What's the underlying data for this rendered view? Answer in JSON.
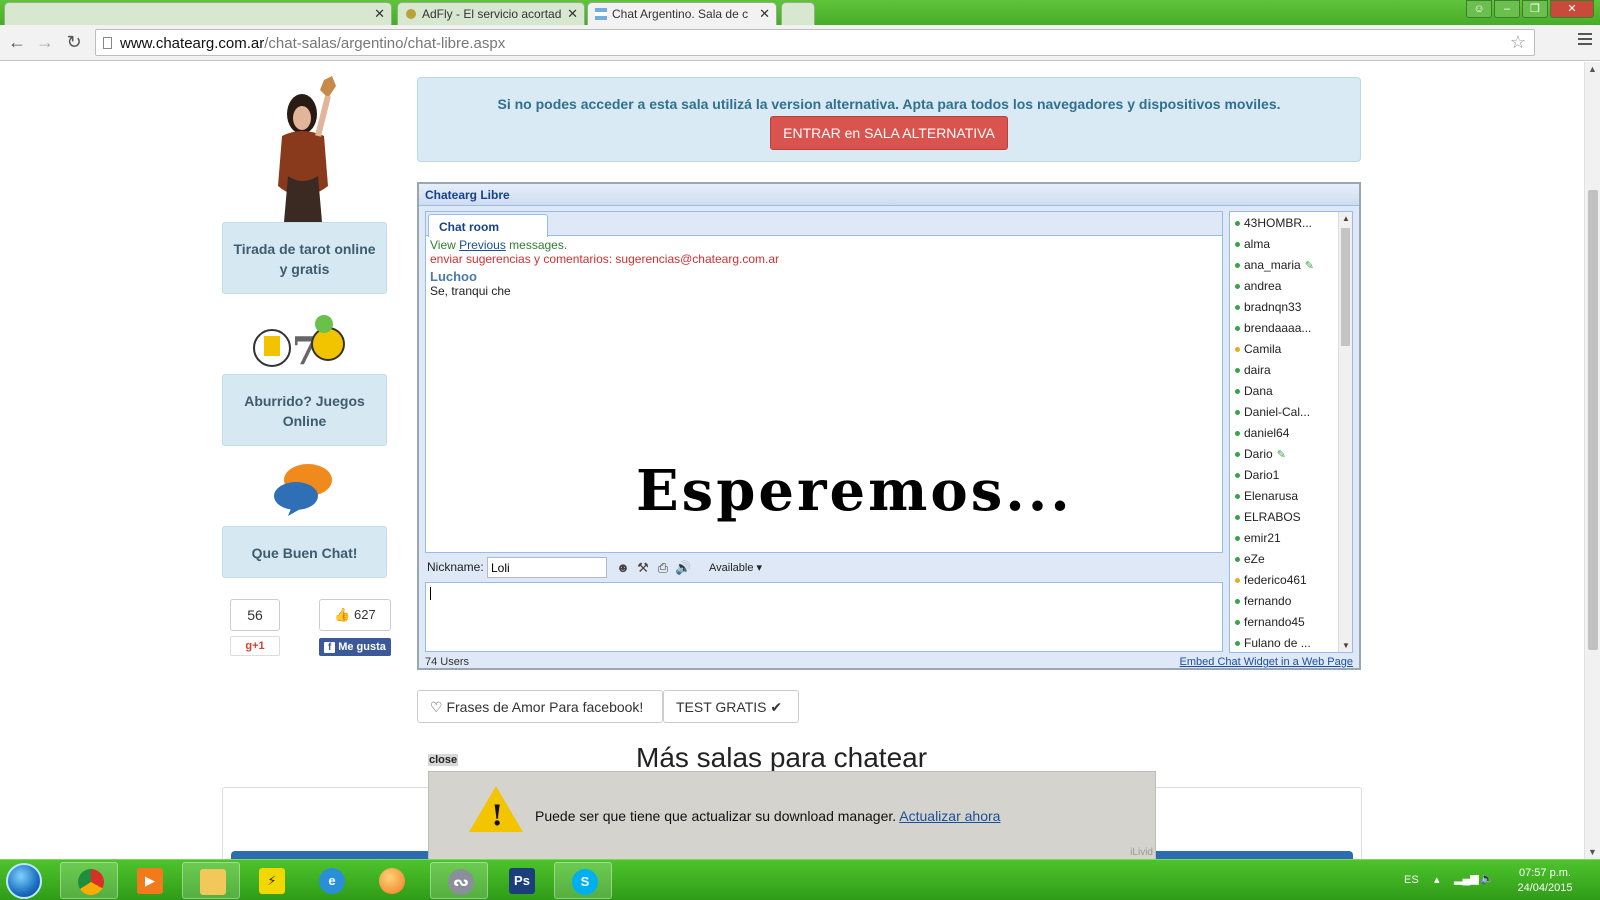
{
  "browser": {
    "tabs": [
      {
        "title": "",
        "active": false
      },
      {
        "title": "AdFly - El servicio acortad",
        "active": false
      },
      {
        "title": "Chat Argentino. Sala de c",
        "active": true
      }
    ],
    "url_host": "www.chatearg.com.ar",
    "url_path": "/chat-salas/argentino/chat-libre.aspx"
  },
  "sidebar": {
    "tarot": "Tirada de tarot online y gratis",
    "games": "Aburrido? Juegos Online",
    "chat": "Que Buen Chat!",
    "gplus_count": "56",
    "gplus_label": "+1",
    "like_count": "627",
    "fb_label": "Me gusta"
  },
  "alert": {
    "text": "Si no podes acceder a esta sala utilizá la version alternativa. Apta para todos los navegadores y dispositivos moviles.",
    "button": "ENTRAR en SALA ALTERNATIVA"
  },
  "chat": {
    "title": "Chatearg Libre",
    "tab": "Chat room",
    "view_prefix": "View ",
    "view_link": "Previous",
    "view_suffix": " messages.",
    "system_msg": "enviar sugerencias y comentarios: sugerencias@chatearg.com.ar",
    "message_user": "Luchoo",
    "message_text": "Se, tranqui che",
    "overlay": "Esperemos...",
    "nickname_label": "Nickname:",
    "nickname_value": "Loli",
    "status": "Available ▾",
    "users_count": "74 Users",
    "embed": "Embed Chat Widget in a Web Page",
    "users": [
      {
        "name": "43HOMBR...",
        "away": false
      },
      {
        "name": "alma",
        "away": false
      },
      {
        "name": "ana_maria",
        "away": false,
        "pen": true
      },
      {
        "name": "andrea",
        "away": false
      },
      {
        "name": "bradnqn33",
        "away": false
      },
      {
        "name": "brendaaaa...",
        "away": false
      },
      {
        "name": "Camila",
        "away": true
      },
      {
        "name": "daira",
        "away": false
      },
      {
        "name": "Dana",
        "away": false
      },
      {
        "name": "Daniel-Cal...",
        "away": false
      },
      {
        "name": "daniel64",
        "away": false
      },
      {
        "name": "Dario",
        "away": false,
        "pen": true
      },
      {
        "name": "Dario1",
        "away": false
      },
      {
        "name": "Elenarusa",
        "away": false
      },
      {
        "name": "ELRABOS",
        "away": false
      },
      {
        "name": "emir21",
        "away": false
      },
      {
        "name": "eZe",
        "away": false
      },
      {
        "name": "federico461",
        "away": true
      },
      {
        "name": "fernando",
        "away": false
      },
      {
        "name": "fernando45",
        "away": false
      },
      {
        "name": "Fulano de ...",
        "away": false
      }
    ]
  },
  "buttons": {
    "frases": "♡ Frases de Amor Para facebook!",
    "test": "TEST GRATIS ✔"
  },
  "more_rooms": "Más salas para chatear",
  "close_label": "close",
  "download": {
    "message": "Puede ser que tiene que actualizar su download manager.",
    "link": "Actualizar ahora",
    "brand": "iLivid"
  },
  "taskbar": {
    "lang": "ES",
    "time": "07:57 p.m.",
    "date": "24/04/2015"
  }
}
